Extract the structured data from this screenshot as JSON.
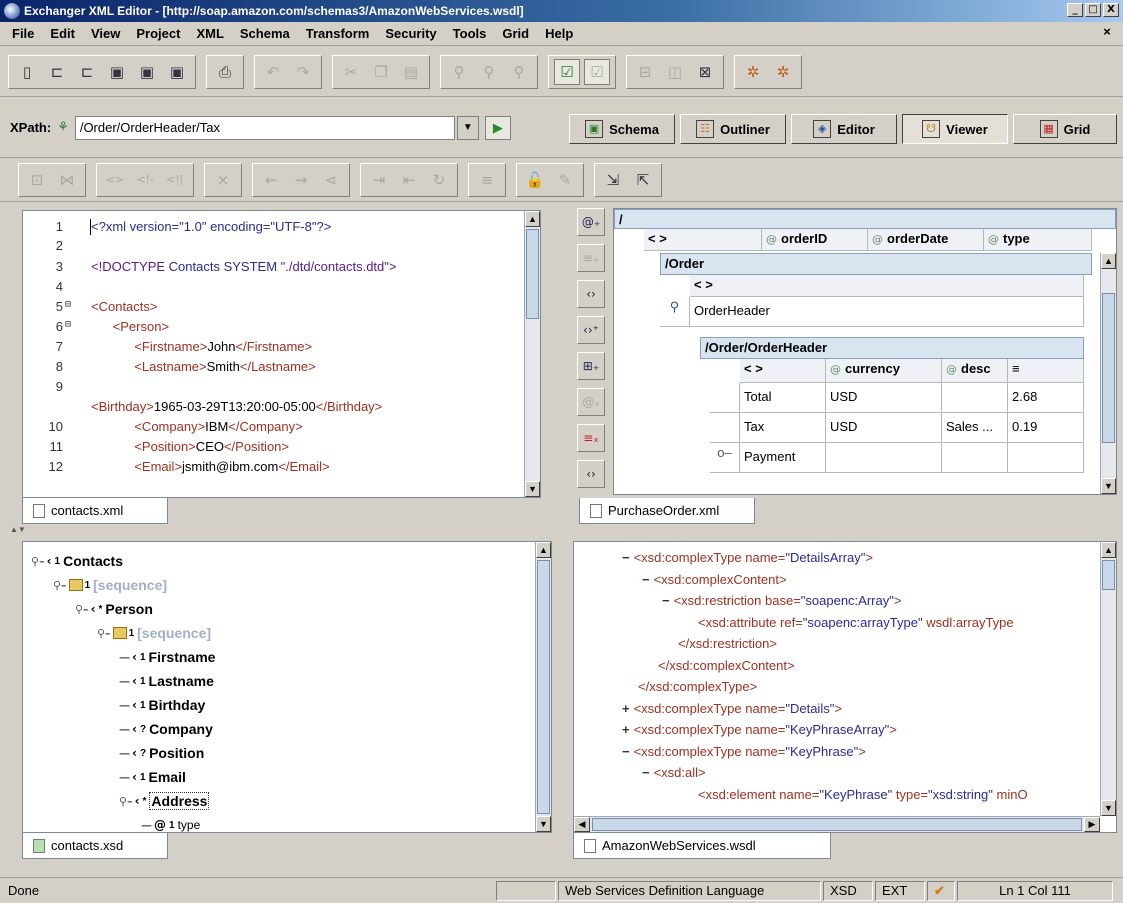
{
  "window": {
    "title": "Exchanger XML Editor - [http://soap.amazon.com/schemas3/AmazonWebServices.wsdl]",
    "minimize": "_",
    "maximize": "□",
    "close": "X"
  },
  "menu": {
    "items": [
      "File",
      "Edit",
      "View",
      "Project",
      "XML",
      "Schema",
      "Transform",
      "Security",
      "Tools",
      "Grid",
      "Help"
    ],
    "close": "×"
  },
  "xpath": {
    "label": "XPath:",
    "value": "/Order/OrderHeader/Tax"
  },
  "views": {
    "schema": "Schema",
    "outliner": "Outliner",
    "editor": "Editor",
    "viewer": "Viewer",
    "grid": "Grid"
  },
  "editor": {
    "tab": "contacts.xml",
    "lines": [
      {
        "no": "1",
        "fold": "",
        "parts": [
          [
            "pi",
            "<?xml version=\"1.0\" encoding=\"UTF-8\"?>"
          ]
        ]
      },
      {
        "no": "2",
        "fold": "",
        "parts": []
      },
      {
        "no": "3",
        "fold": "",
        "parts": [
          [
            "dtd",
            "<!DOCTYPE "
          ],
          [
            "val",
            "Contacts SYSTEM "
          ],
          [
            "dtd",
            "\"./dtd/contacts.dtd\">"
          ]
        ]
      },
      {
        "no": "4",
        "fold": "",
        "parts": []
      },
      {
        "no": "5",
        "fold": "⊟",
        "parts": [
          [
            "tag",
            "<Contacts>"
          ]
        ]
      },
      {
        "no": "6",
        "fold": "⊟",
        "parts": [
          [
            "sp",
            "      "
          ],
          [
            "tag",
            "<Person>"
          ]
        ]
      },
      {
        "no": "7",
        "fold": "",
        "parts": [
          [
            "sp",
            "            "
          ],
          [
            "tag",
            "<Firstname>"
          ],
          [
            "txt",
            "John"
          ],
          [
            "tag",
            "</Firstname>"
          ]
        ]
      },
      {
        "no": "8",
        "fold": "",
        "parts": [
          [
            "sp",
            "            "
          ],
          [
            "tag",
            "<Lastname>"
          ],
          [
            "txt",
            "Smith"
          ],
          [
            "tag",
            "</Lastname>"
          ]
        ]
      },
      {
        "no": "9",
        "fold": "",
        "parts": []
      },
      {
        "no": "",
        "fold": "",
        "parts": [
          [
            "tag",
            "<Birthday>"
          ],
          [
            "txt",
            "1965-03-29T13:20:00-05:00"
          ],
          [
            "tag",
            "</Birthday>"
          ]
        ]
      },
      {
        "no": "10",
        "fold": "",
        "parts": [
          [
            "sp",
            "            "
          ],
          [
            "tag",
            "<Company>"
          ],
          [
            "txt",
            "IBM"
          ],
          [
            "tag",
            "</Company>"
          ]
        ]
      },
      {
        "no": "11",
        "fold": "",
        "parts": [
          [
            "sp",
            "            "
          ],
          [
            "tag",
            "<Position>"
          ],
          [
            "txt",
            "CEO"
          ],
          [
            "tag",
            "</Position>"
          ]
        ]
      },
      {
        "no": "12",
        "fold": "",
        "parts": [
          [
            "sp",
            "            "
          ],
          [
            "tag",
            "<Email>"
          ],
          [
            "txt",
            "jsmith@ibm.com"
          ],
          [
            "tag",
            "</Email>"
          ]
        ]
      }
    ]
  },
  "grid": {
    "tab": "PurchaseOrder.xml",
    "root_path": "/",
    "root_cols": [
      "< >",
      "orderID",
      "orderDate",
      "type"
    ],
    "order_path": "/Order",
    "order_col": "< >",
    "order_row": "OrderHeader",
    "header_path": "/Order/OrderHeader",
    "header_cols": [
      "< >",
      "currency",
      "desc",
      "≡"
    ],
    "rows": [
      [
        "Total",
        "USD",
        "",
        "2.68"
      ],
      [
        "Tax",
        "USD",
        "Sales ...",
        "0.19"
      ],
      [
        "Payment",
        "",
        "",
        ""
      ]
    ]
  },
  "tree": {
    "tab": "contacts.xsd",
    "items": [
      {
        "label": "Contacts",
        "mark": "1",
        "indent": 0,
        "kind": "el"
      },
      {
        "label": "[sequence]",
        "mark": "1",
        "indent": 1,
        "kind": "seq"
      },
      {
        "label": "Person",
        "mark": "*",
        "indent": 2,
        "kind": "el"
      },
      {
        "label": "[sequence]",
        "mark": "1",
        "indent": 3,
        "kind": "seq"
      },
      {
        "label": "Firstname",
        "mark": "1",
        "indent": 4,
        "kind": "el"
      },
      {
        "label": "Lastname",
        "mark": "1",
        "indent": 4,
        "kind": "el"
      },
      {
        "label": "Birthday",
        "mark": "1",
        "indent": 4,
        "kind": "el"
      },
      {
        "label": "Company",
        "mark": "?",
        "indent": 4,
        "kind": "el"
      },
      {
        "label": "Position",
        "mark": "?",
        "indent": 4,
        "kind": "el"
      },
      {
        "label": "Email",
        "mark": "1",
        "indent": 4,
        "kind": "el"
      },
      {
        "label": "Address",
        "mark": "*",
        "indent": 4,
        "kind": "el"
      },
      {
        "label": "type",
        "mark": "1",
        "indent": 5,
        "kind": "attr"
      }
    ]
  },
  "schema": {
    "tab": "AmazonWebServices.wsdl",
    "lines": [
      {
        "pm": "−",
        "indent": 0,
        "parts": [
          [
            "tag",
            "<xsd:complexType "
          ],
          [
            "attr",
            "name="
          ],
          [
            "val",
            "\"DetailsArray\""
          ],
          [
            "tag",
            ">"
          ]
        ]
      },
      {
        "pm": "−",
        "indent": 1,
        "parts": [
          [
            "tag",
            "<xsd:complexContent>"
          ]
        ]
      },
      {
        "pm": "−",
        "indent": 2,
        "parts": [
          [
            "tag",
            "<xsd:restriction "
          ],
          [
            "attr",
            "base="
          ],
          [
            "val",
            "\"soapenc:Array\""
          ],
          [
            "tag",
            ">"
          ]
        ]
      },
      {
        "pm": "",
        "indent": 3,
        "parts": [
          [
            "tag",
            "<xsd:attribute "
          ],
          [
            "attr",
            "ref="
          ],
          [
            "val",
            "\"soapenc:arrayType\""
          ],
          [
            "attr",
            " wsdl:arrayType"
          ]
        ]
      },
      {
        "pm": "",
        "indent": 2,
        "parts": [
          [
            "tag",
            "</xsd:restriction>"
          ]
        ]
      },
      {
        "pm": "",
        "indent": 1,
        "parts": [
          [
            "tag",
            "</xsd:complexContent>"
          ]
        ]
      },
      {
        "pm": "",
        "indent": 0,
        "parts": [
          [
            "tag",
            "</xsd:complexType>"
          ]
        ]
      },
      {
        "pm": "+",
        "indent": 0,
        "parts": [
          [
            "tag",
            "<xsd:complexType "
          ],
          [
            "attr",
            "name="
          ],
          [
            "val",
            "\"Details\""
          ],
          [
            "tag",
            ">"
          ]
        ]
      },
      {
        "pm": "+",
        "indent": 0,
        "parts": [
          [
            "tag",
            "<xsd:complexType "
          ],
          [
            "attr",
            "name="
          ],
          [
            "val",
            "\"KeyPhraseArray\""
          ],
          [
            "tag",
            ">"
          ]
        ]
      },
      {
        "pm": "−",
        "indent": 0,
        "parts": [
          [
            "tag",
            "<xsd:complexType "
          ],
          [
            "attr",
            "name="
          ],
          [
            "val",
            "\"KeyPhrase\""
          ],
          [
            "tag",
            ">"
          ]
        ]
      },
      {
        "pm": "−",
        "indent": 1,
        "parts": [
          [
            "tag",
            "<xsd:all>"
          ]
        ]
      },
      {
        "pm": "",
        "indent": 3,
        "parts": [
          [
            "tag",
            "<xsd:element "
          ],
          [
            "attr",
            "name="
          ],
          [
            "val",
            "\"KeyPhrase\""
          ],
          [
            "attr",
            " type="
          ],
          [
            "val",
            "\"xsd:string\""
          ],
          [
            "attr",
            " minO"
          ]
        ]
      }
    ]
  },
  "status": {
    "left": "Done",
    "language": "Web Services Definition Language",
    "xsd": "XSD",
    "ext": "EXT",
    "check": "✔",
    "position": "Ln 1 Col 111"
  },
  "colors": {
    "tag": "#a03020",
    "value": "#2a2a9a",
    "title_start": "#0a246a",
    "title_end": "#a6caf0"
  }
}
